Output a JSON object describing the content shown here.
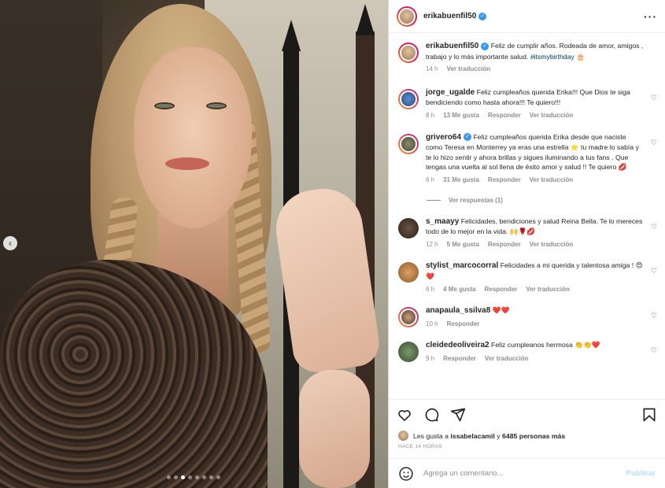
{
  "post": {
    "author": "erikabuenfil50",
    "caption_text": "Feliz de cumplir años. Rodeada de amor, amigos , trabajo y lo más importante salud.",
    "caption_tag": "#itsmybirthday",
    "caption_emoji": "🎂",
    "caption_time": "14 h",
    "see_translation": "Ver traducción"
  },
  "comments": [
    {
      "user": "jorge_ugalde",
      "verified": false,
      "text": "Feliz cumpleaños querida Erika!!! Que Dios te siga bendiciendo como hasta ahora!!! Te quiero!!!",
      "time": "8 h",
      "likes": "13 Me gusta",
      "reply": "Responder",
      "translate": "Ver traducción"
    },
    {
      "user": "grivero64",
      "verified": true,
      "text": "Feliz cumpleaños querida Erika desde que naciste como Teresa en Monterrey ya eras una estrella ⭐ tu madre lo sabía y te lo hizo sentir y ahora brillas y sigues iluminando a tus fans . Que tengas una vuelta al sol llena de éxito amor y salud !! Te quiero 💋",
      "time": "6 h",
      "likes": "31 Me gusta",
      "reply": "Responder",
      "translate": "Ver traducción",
      "view_replies": "Ver respuestas (1)"
    },
    {
      "user": "s_maayy",
      "verified": false,
      "text": "Felicidades, bendiciones y salud Reina Bella. Te lo mereces todo de lo mejor en la vida. 🙌🌹💋",
      "time": "12 h",
      "likes": "5 Me gusta",
      "reply": "Responder",
      "translate": "Ver traducción"
    },
    {
      "user": "stylist_marcocorral",
      "verified": false,
      "text": "Felicidades a mi querida y talentosa amiga ! 😍❤️",
      "time": "6 h",
      "likes": "4 Me gusta",
      "reply": "Responder",
      "translate": "Ver traducción"
    },
    {
      "user": "anapaula_ssilva8",
      "verified": false,
      "text": "❤️❤️",
      "time": "10 h",
      "likes": "",
      "reply": "Responder",
      "translate": ""
    },
    {
      "user": "cleidedeoliveira2",
      "verified": false,
      "text": "Feliz cumpleanos hermosa 👏👏❤️",
      "time": "9 h",
      "likes": "",
      "reply": "Responder",
      "translate": "Ver traducción"
    }
  ],
  "likes": {
    "prefix": "Les gusta a",
    "user": "issabelacamil",
    "conj": "y",
    "others": "6485 personas más"
  },
  "posted_ago": "HACE 14 HORAS",
  "composer": {
    "placeholder": "Agrega un comentario...",
    "publish": "Publicar"
  },
  "icons": {
    "like": "heart-icon",
    "comment": "comment-icon",
    "share": "share-icon",
    "save": "bookmark-icon",
    "emoji": "emoji-icon",
    "more": "more-icon",
    "prev": "chevron-left-icon"
  },
  "carousel": {
    "total": 8,
    "active": 2
  },
  "colors": {
    "link": "#00376b",
    "verified": "#3897f0",
    "publish": "#b2dffc"
  }
}
